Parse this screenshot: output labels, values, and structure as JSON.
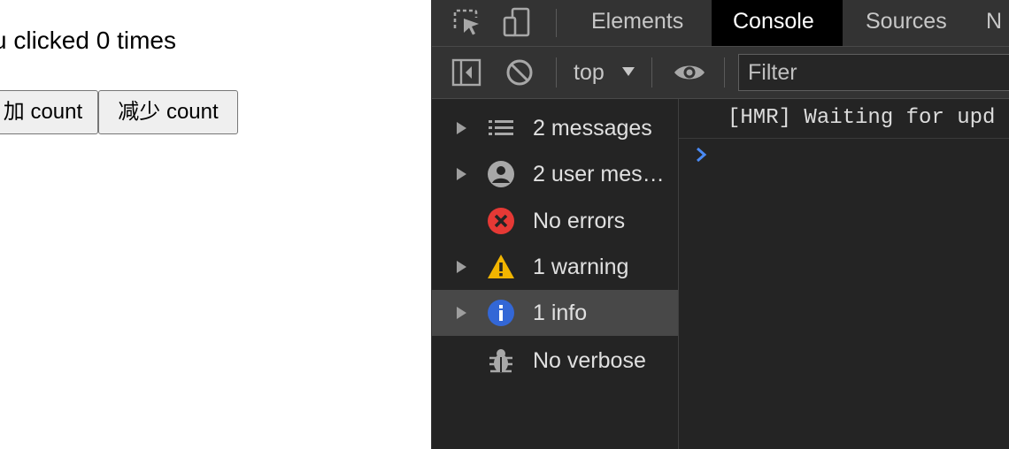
{
  "page": {
    "counter_text": "u clicked 0 times",
    "increase_label": "加 count",
    "decrease_label": "减少 count"
  },
  "devtools": {
    "tabs": [
      {
        "label": "Elements",
        "active": false
      },
      {
        "label": "Console",
        "active": true
      },
      {
        "label": "Sources",
        "active": false
      },
      {
        "label": "N",
        "active": false
      }
    ],
    "toolbar": {
      "context": "top",
      "filter_placeholder": "Filter"
    },
    "sidebar": [
      {
        "label": "2 messages",
        "icon": "list-icon"
      },
      {
        "label": "2 user mes…",
        "icon": "user-icon"
      },
      {
        "label": "No errors",
        "icon": "error-icon"
      },
      {
        "label": "1 warning",
        "icon": "warning-icon"
      },
      {
        "label": "1 info",
        "icon": "info-icon",
        "selected": true
      },
      {
        "label": "No verbose",
        "icon": "bug-icon"
      }
    ],
    "console": {
      "log_line": "[HMR] Waiting for upd",
      "prompt_symbol": "›"
    },
    "colors": {
      "error": "#e53935",
      "warning": "#f2b500",
      "info": "#3367d6",
      "prompt": "#4a8af4"
    }
  }
}
